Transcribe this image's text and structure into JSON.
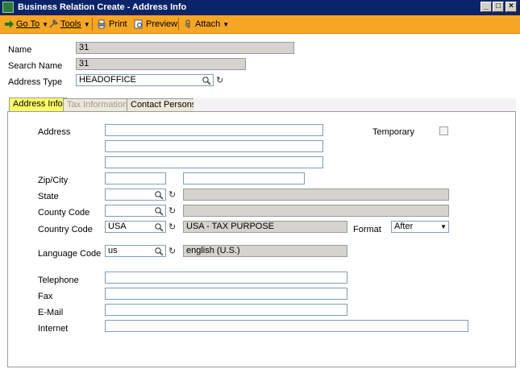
{
  "window": {
    "title": "Business Relation Create - Address Info",
    "controls": [
      "minimize-icon",
      "maximize-icon",
      "close-icon"
    ]
  },
  "toolbar": {
    "goto_label": "Go To",
    "tools_label": "Tools",
    "print_label": "Print",
    "preview_label": "Preview",
    "attach_label": "Attach"
  },
  "header": {
    "name_label": "Name",
    "name_value": "31",
    "search_name_label": "Search Name",
    "search_name_value": "31",
    "address_type_label": "Address Type",
    "address_type_value": "HEADOFFICE"
  },
  "tabs": [
    {
      "label": "Address Info",
      "state": "active"
    },
    {
      "label": "Tax Information",
      "state": "disabled"
    },
    {
      "label": "Contact Persons",
      "state": "normal"
    }
  ],
  "form": {
    "address_label": "Address",
    "address_lines": [
      "",
      "",
      ""
    ],
    "temporary_label": "Temporary",
    "zipcity_label": "Zip/City",
    "zip_value": "",
    "city_value": "",
    "state_label": "State",
    "state_value": "",
    "state_desc": "",
    "county_label": "County Code",
    "county_value": "",
    "county_desc": "",
    "country_label": "Country Code",
    "country_value": "USA",
    "country_desc": "USA - TAX PURPOSE",
    "format_label": "Format",
    "format_value": "After",
    "language_label": "Language Code",
    "language_value": "us",
    "language_desc": "english (U.S.)",
    "telephone_label": "Telephone",
    "fax_label": "Fax",
    "email_label": "E-Mail",
    "internet_label": "Internet"
  },
  "colors": {
    "titlebar": "#0a246a",
    "toolbar": "#f5a623",
    "active_tab": "#ffff66"
  }
}
